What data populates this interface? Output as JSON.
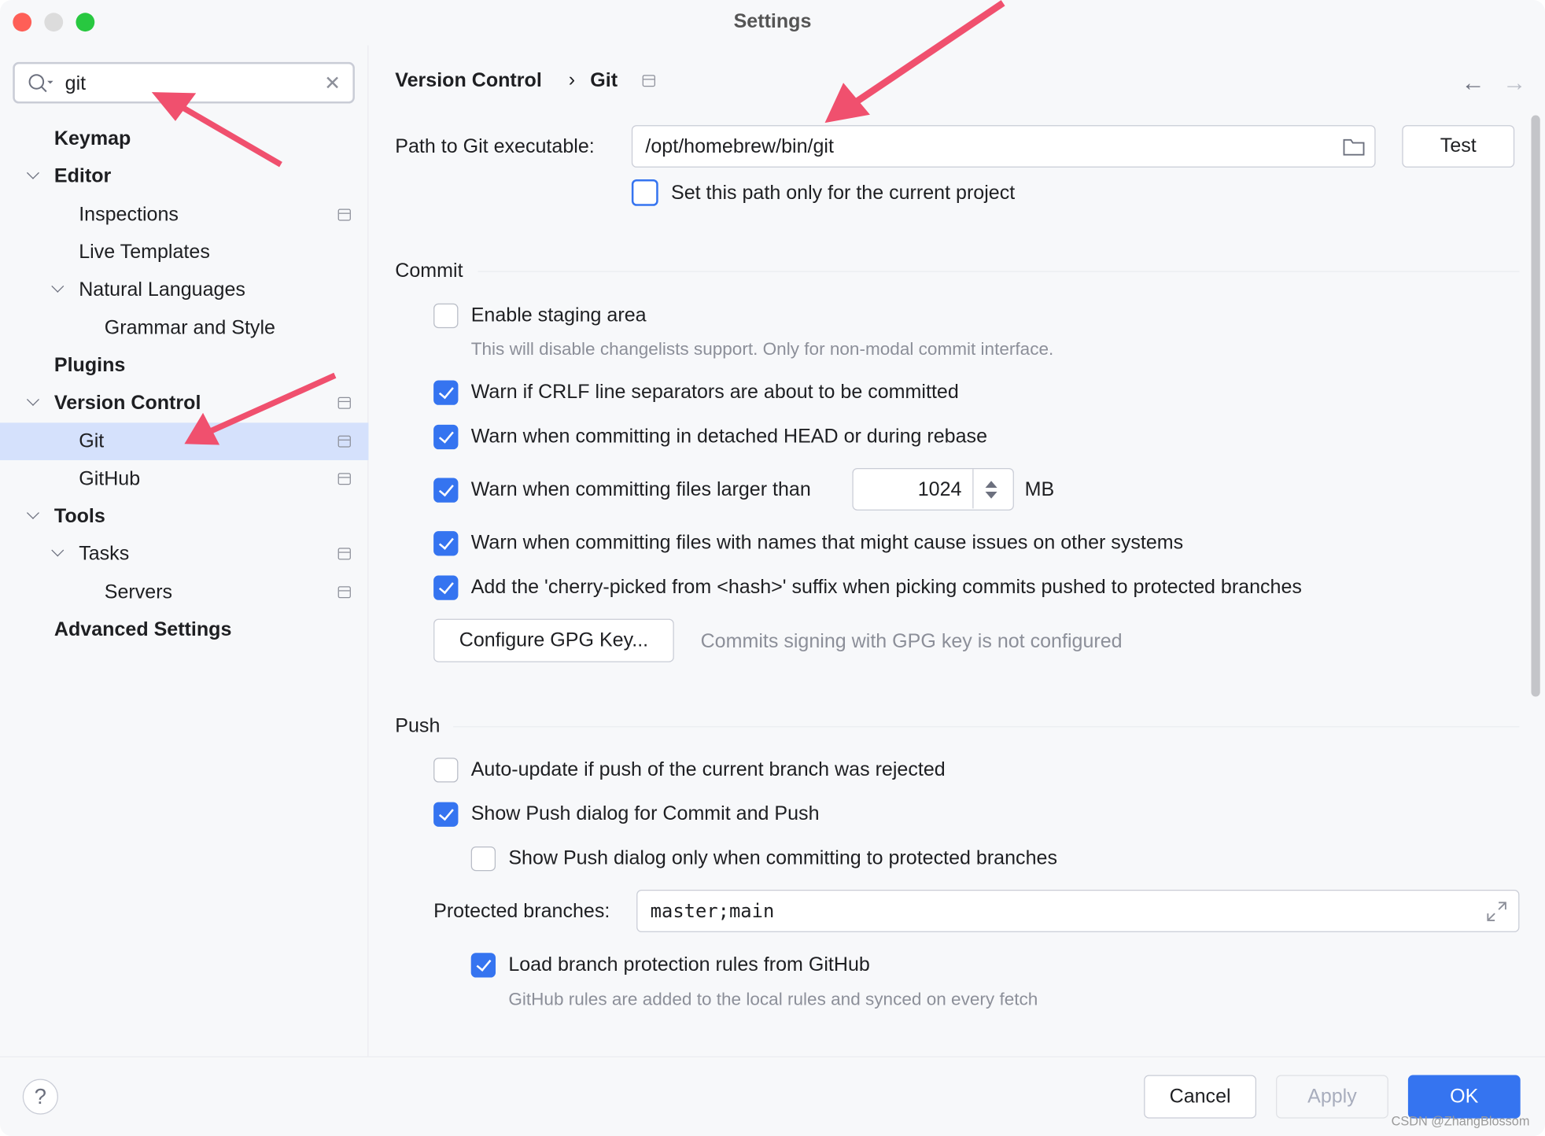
{
  "window": {
    "title": "Settings"
  },
  "sidebar": {
    "search": {
      "value": "git"
    },
    "items": [
      {
        "label": "Keymap",
        "level": 0,
        "bold": true
      },
      {
        "label": "Editor",
        "level": 0,
        "bold": true,
        "expanded": true
      },
      {
        "label": "Inspections",
        "level": 1,
        "project_icon": true
      },
      {
        "label": "Live Templates",
        "level": 1
      },
      {
        "label": "Natural Languages",
        "level": 1,
        "expanded": true
      },
      {
        "label": "Grammar and Style",
        "level": 2
      },
      {
        "label": "Plugins",
        "level": 0,
        "bold": true
      },
      {
        "label": "Version Control",
        "level": 0,
        "bold": true,
        "expanded": true,
        "project_icon": true
      },
      {
        "label": "Git",
        "level": 1,
        "selected": true,
        "project_icon": true
      },
      {
        "label": "GitHub",
        "level": 1,
        "project_icon": true
      },
      {
        "label": "Tools",
        "level": 0,
        "bold": true,
        "expanded": true
      },
      {
        "label": "Tasks",
        "level": 1,
        "expanded": true,
        "project_icon": true
      },
      {
        "label": "Servers",
        "level": 2,
        "project_icon": true
      },
      {
        "label": "Advanced Settings",
        "level": 0,
        "bold": true
      }
    ]
  },
  "breadcrumb": {
    "parent": "Version Control",
    "separator": "›",
    "current": "Git"
  },
  "git_path": {
    "label": "Path to Git executable:",
    "value": "/opt/homebrew/bin/git",
    "test_button": "Test",
    "project_only_label": "Set this path only for the current project",
    "project_only_checked": false
  },
  "commit": {
    "title": "Commit",
    "staging": {
      "label": "Enable staging area",
      "checked": false,
      "hint": "This will disable changelists support. Only for non-modal commit interface."
    },
    "crlf": {
      "label": "Warn if CRLF line separators are about to be committed",
      "checked": true
    },
    "detached": {
      "label": "Warn when committing in detached HEAD or during rebase",
      "checked": true
    },
    "large": {
      "label": "Warn when committing files larger than",
      "checked": true,
      "value": "1024",
      "unit": "MB"
    },
    "names": {
      "label": "Warn when committing files with names that might cause issues on other systems",
      "checked": true
    },
    "cherry": {
      "label": "Add the 'cherry-picked from <hash>' suffix when picking commits pushed to protected branches",
      "checked": true
    },
    "gpg_button": "Configure GPG Key...",
    "gpg_status": "Commits signing with GPG key is not configured"
  },
  "push": {
    "title": "Push",
    "auto_update": {
      "label": "Auto-update if push of the current branch was rejected",
      "checked": false
    },
    "show_dialog": {
      "label": "Show Push dialog for Commit and Push",
      "checked": true
    },
    "only_protected": {
      "label": "Show Push dialog only when committing to protected branches",
      "checked": false
    },
    "protected_label": "Protected branches:",
    "protected_value": "master;main",
    "github_rules": {
      "label": "Load branch protection rules from GitHub",
      "checked": true,
      "hint": "GitHub rules are added to the local rules and synced on every fetch"
    }
  },
  "footer": {
    "help": "?",
    "cancel": "Cancel",
    "apply": "Apply",
    "ok": "OK"
  },
  "watermark": "CSDN @ZhangBlossom",
  "colors": {
    "accent": "#3574f0",
    "selection": "#d5e1fc",
    "annotation_arrow": "#f0506e"
  }
}
